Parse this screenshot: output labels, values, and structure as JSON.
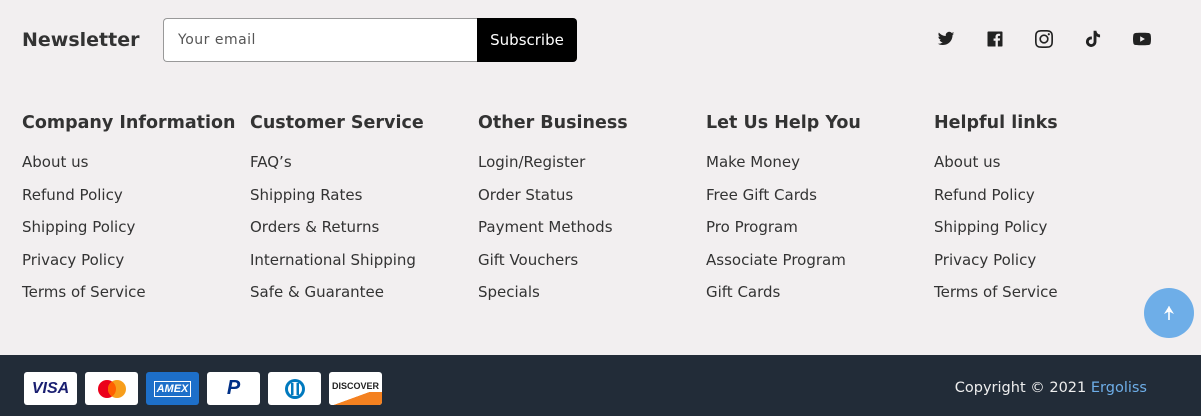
{
  "newsletter": {
    "title": "Newsletter",
    "email_placeholder": "Your email",
    "subscribe_label": "Subscribe"
  },
  "social": [
    "twitter-icon",
    "facebook-icon",
    "instagram-icon",
    "tiktok-icon",
    "youtube-icon"
  ],
  "columns": [
    {
      "title": "Company Information",
      "links": [
        "About us",
        "Refund Policy",
        "Shipping Policy",
        "Privacy Policy",
        "Terms of Service"
      ]
    },
    {
      "title": "Customer Service",
      "links": [
        "FAQ’s",
        "Shipping Rates",
        "Orders & Returns",
        "International Shipping",
        "Safe & Guarantee"
      ]
    },
    {
      "title": "Other Business",
      "links": [
        "Login/Register",
        "Order Status",
        "Payment Methods",
        "Gift Vouchers",
        "Specials"
      ]
    },
    {
      "title": "Let Us Help You",
      "links": [
        "Make Money",
        "Free Gift Cards",
        "Pro Program",
        "Associate Program",
        "Gift Cards"
      ]
    },
    {
      "title": "Helpful links",
      "links": [
        "About us",
        "Refund Policy",
        "Shipping Policy",
        "Privacy Policy",
        "Terms of Service"
      ]
    }
  ],
  "payment_cards": {
    "visa": "VISA",
    "amex": "AMEX",
    "paypal": "P",
    "discover": "DISCOVER"
  },
  "footer": {
    "copyright_prefix": "Copyright © 2021",
    "brand": "Ergoliss"
  },
  "colors": {
    "background": "#f2eff0",
    "bottom_bar": "#222c38",
    "accent": "#6eaee8"
  }
}
